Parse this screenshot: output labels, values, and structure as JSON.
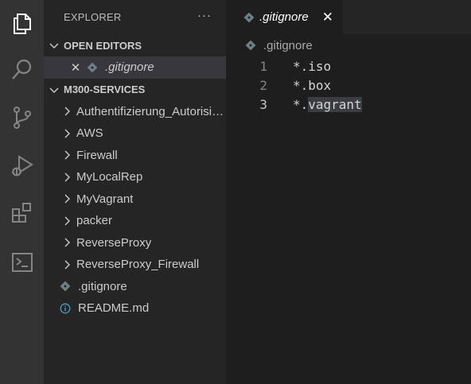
{
  "colors": {
    "activity_bar": "#333333",
    "sidebar": "#252526",
    "editor": "#1e1e1e",
    "selection": "#37373d",
    "git_file": "#6d8086",
    "info_icon": "#519aba"
  },
  "sidebar": {
    "title": "EXPLORER",
    "more_label": "···",
    "open_editors": {
      "title": "OPEN EDITORS",
      "items": [
        {
          "label": ".gitignore",
          "close": "✕",
          "icon": "git-file-icon"
        }
      ]
    },
    "workspace": {
      "title": "M300-SERVICES",
      "folders": [
        "Authentifizierung_Autorisierung",
        "AWS",
        "Firewall",
        "MyLocalRep",
        "MyVagrant",
        "packer",
        "ReverseProxy",
        "ReverseProxy_Firewall"
      ],
      "files": [
        {
          "label": ".gitignore",
          "icon": "git-file-icon"
        },
        {
          "label": "README.md",
          "icon": "info-icon"
        }
      ]
    }
  },
  "editor": {
    "tab": {
      "label": ".gitignore",
      "close": "✕"
    },
    "breadcrumb": ".gitignore",
    "lines": [
      {
        "number": "1",
        "text": "*.iso"
      },
      {
        "number": "2",
        "text": "*.box"
      },
      {
        "number": "3",
        "text_prefix": "*.",
        "text_highlight": "vagrant"
      }
    ]
  }
}
